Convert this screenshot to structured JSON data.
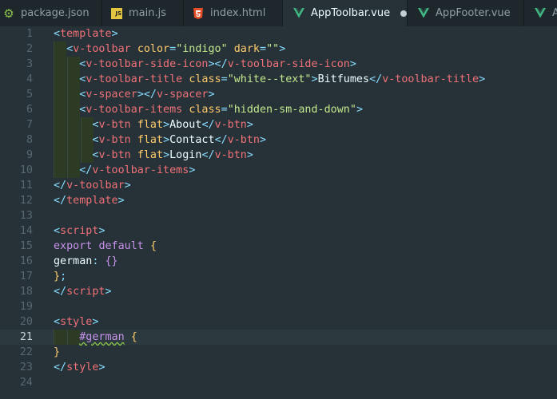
{
  "tabs": [
    {
      "label": "package.json",
      "icon": "gear-icon",
      "active": false
    },
    {
      "label": "main.js",
      "icon": "js-icon",
      "icon_text": "JS",
      "active": false
    },
    {
      "label": "index.html",
      "icon": "html5-icon",
      "active": false
    },
    {
      "label": "AppToolbar.vue",
      "icon": "vue-icon",
      "active": true,
      "modified": true
    },
    {
      "label": "AppFooter.vue",
      "icon": "vue-icon",
      "active": false
    },
    {
      "label": "A",
      "icon": "vue-icon",
      "active": false
    }
  ],
  "editor": {
    "current_line": 21,
    "lines": [
      {
        "n": "1",
        "tokens": [
          [
            "punc",
            "<"
          ],
          [
            "tag",
            "template"
          ],
          [
            "punc",
            ">"
          ]
        ]
      },
      {
        "n": "2",
        "tokens": [
          [
            "text",
            "  "
          ],
          [
            "punc",
            "<"
          ],
          [
            "tag",
            "v-toolbar"
          ],
          [
            "text",
            " "
          ],
          [
            "attr",
            "color"
          ],
          [
            "punc",
            "="
          ],
          [
            "str",
            "\"indigo\""
          ],
          [
            "text",
            " "
          ],
          [
            "attr",
            "dark"
          ],
          [
            "punc",
            "="
          ],
          [
            "str",
            "\"\""
          ],
          [
            "punc",
            ">"
          ]
        ]
      },
      {
        "n": "3",
        "tokens": [
          [
            "text",
            "    "
          ],
          [
            "punc",
            "<"
          ],
          [
            "tag",
            "v-toolbar-side-icon"
          ],
          [
            "punc",
            "></"
          ],
          [
            "tag",
            "v-toolbar-side-icon"
          ],
          [
            "punc",
            ">"
          ]
        ]
      },
      {
        "n": "4",
        "tokens": [
          [
            "text",
            "    "
          ],
          [
            "punc",
            "<"
          ],
          [
            "tag",
            "v-toolbar-title"
          ],
          [
            "text",
            " "
          ],
          [
            "attr",
            "class"
          ],
          [
            "punc",
            "="
          ],
          [
            "str",
            "\"white--text\""
          ],
          [
            "punc",
            ">"
          ],
          [
            "text",
            "Bitfumes"
          ],
          [
            "punc",
            "</"
          ],
          [
            "tag",
            "v-toolbar-title"
          ],
          [
            "punc",
            ">"
          ]
        ]
      },
      {
        "n": "5",
        "tokens": [
          [
            "text",
            "    "
          ],
          [
            "punc",
            "<"
          ],
          [
            "tag",
            "v-spacer"
          ],
          [
            "punc",
            "></"
          ],
          [
            "tag",
            "v-spacer"
          ],
          [
            "punc",
            ">"
          ]
        ]
      },
      {
        "n": "6",
        "tokens": [
          [
            "text",
            "    "
          ],
          [
            "punc",
            "<"
          ],
          [
            "tag",
            "v-toolbar-items"
          ],
          [
            "text",
            " "
          ],
          [
            "attr",
            "class"
          ],
          [
            "punc",
            "="
          ],
          [
            "str",
            "\"hidden-sm-and-down\""
          ],
          [
            "punc",
            ">"
          ]
        ]
      },
      {
        "n": "7",
        "tokens": [
          [
            "text",
            "      "
          ],
          [
            "punc",
            "<"
          ],
          [
            "tag",
            "v-btn"
          ],
          [
            "text",
            " "
          ],
          [
            "attr",
            "flat"
          ],
          [
            "punc",
            ">"
          ],
          [
            "text",
            "About"
          ],
          [
            "punc",
            "</"
          ],
          [
            "tag",
            "v-btn"
          ],
          [
            "punc",
            ">"
          ]
        ]
      },
      {
        "n": "8",
        "tokens": [
          [
            "text",
            "      "
          ],
          [
            "punc",
            "<"
          ],
          [
            "tag",
            "v-btn"
          ],
          [
            "text",
            " "
          ],
          [
            "attr",
            "flat"
          ],
          [
            "punc",
            ">"
          ],
          [
            "text",
            "Contact"
          ],
          [
            "punc",
            "</"
          ],
          [
            "tag",
            "v-btn"
          ],
          [
            "punc",
            ">"
          ]
        ]
      },
      {
        "n": "9",
        "tokens": [
          [
            "text",
            "      "
          ],
          [
            "punc",
            "<"
          ],
          [
            "tag",
            "v-btn"
          ],
          [
            "text",
            " "
          ],
          [
            "attr",
            "flat"
          ],
          [
            "punc",
            ">"
          ],
          [
            "text",
            "Login"
          ],
          [
            "punc",
            "</"
          ],
          [
            "tag",
            "v-btn"
          ],
          [
            "punc",
            ">"
          ]
        ]
      },
      {
        "n": "10",
        "tokens": [
          [
            "text",
            "    "
          ],
          [
            "punc",
            "</"
          ],
          [
            "tag",
            "v-toolbar-items"
          ],
          [
            "punc",
            ">"
          ]
        ]
      },
      {
        "n": "11",
        "tokens": [
          [
            "punc",
            "</"
          ],
          [
            "tag",
            "v-toolbar"
          ],
          [
            "punc",
            ">"
          ]
        ]
      },
      {
        "n": "12",
        "tokens": [
          [
            "punc",
            "</"
          ],
          [
            "tag",
            "template"
          ],
          [
            "punc",
            ">"
          ]
        ]
      },
      {
        "n": "13",
        "tokens": []
      },
      {
        "n": "14",
        "tokens": [
          [
            "punc",
            "<"
          ],
          [
            "tag",
            "script"
          ],
          [
            "punc",
            ">"
          ]
        ]
      },
      {
        "n": "15",
        "tokens": [
          [
            "kw",
            "export"
          ],
          [
            "text",
            " "
          ],
          [
            "kw",
            "default"
          ],
          [
            "text",
            " "
          ],
          [
            "brace",
            "{"
          ]
        ]
      },
      {
        "n": "16",
        "tokens": [
          [
            "text",
            "german"
          ],
          [
            "punc",
            ":"
          ],
          [
            "text",
            " "
          ],
          [
            "brace2",
            "{}"
          ]
        ]
      },
      {
        "n": "17",
        "tokens": [
          [
            "brace",
            "}"
          ],
          [
            "punc",
            ";"
          ]
        ]
      },
      {
        "n": "18",
        "tokens": [
          [
            "punc",
            "</"
          ],
          [
            "tag",
            "script"
          ],
          [
            "punc",
            ">"
          ]
        ]
      },
      {
        "n": "19",
        "tokens": []
      },
      {
        "n": "20",
        "tokens": [
          [
            "punc",
            "<"
          ],
          [
            "tag",
            "style"
          ],
          [
            "punc",
            ">"
          ]
        ]
      },
      {
        "n": "21",
        "tokens": [
          [
            "text",
            "    "
          ],
          [
            "sel",
            "#german"
          ],
          [
            "text",
            " "
          ],
          [
            "brace",
            "{"
          ]
        ]
      },
      {
        "n": "22",
        "tokens": [
          [
            "brace",
            "}"
          ]
        ]
      },
      {
        "n": "23",
        "tokens": [
          [
            "punc",
            "</"
          ],
          [
            "tag",
            "style"
          ],
          [
            "punc",
            ">"
          ]
        ]
      },
      {
        "n": "24",
        "tokens": []
      }
    ]
  }
}
